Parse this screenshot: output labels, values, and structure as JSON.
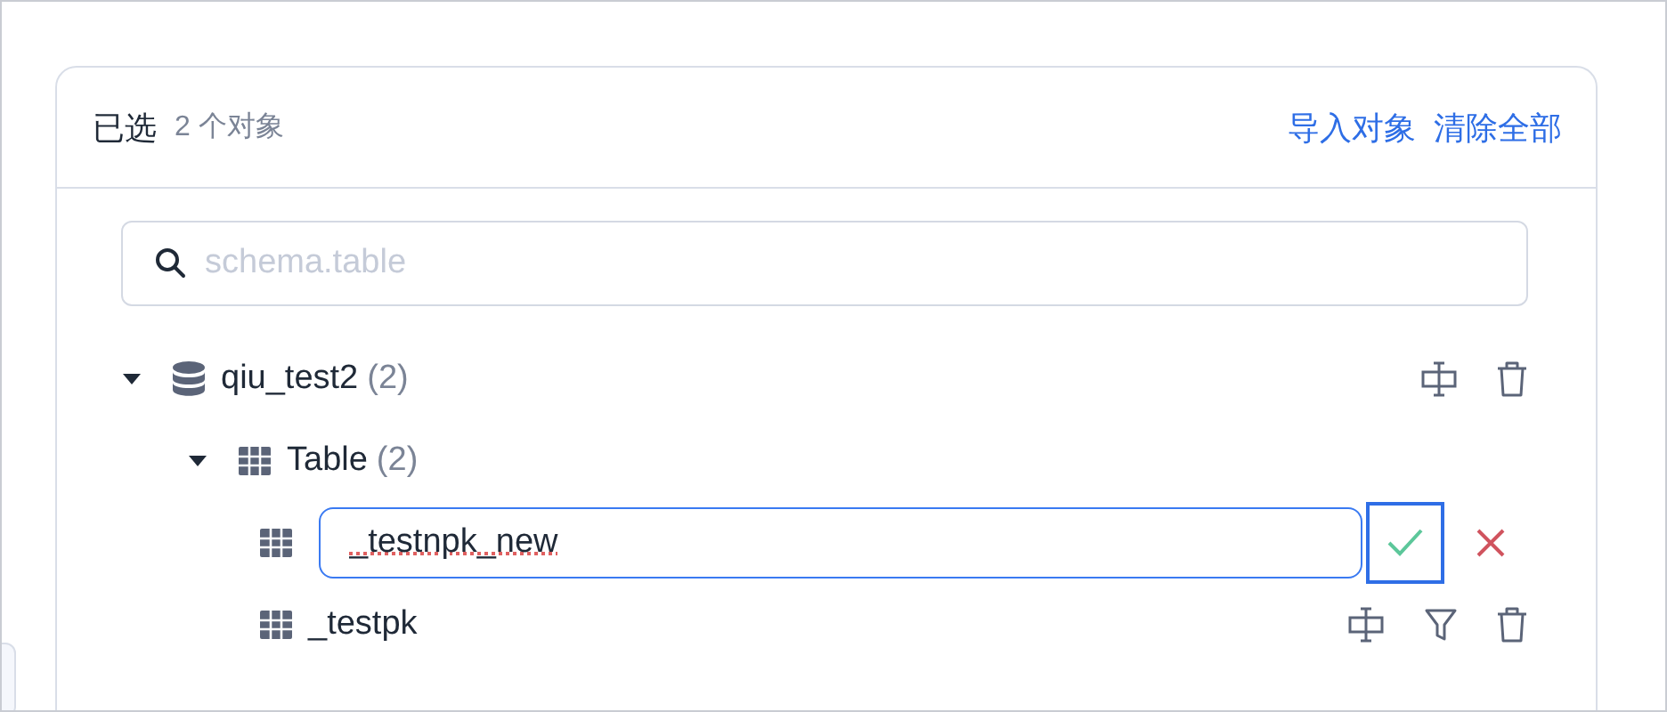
{
  "header": {
    "title": "已选",
    "count": "2 个对象",
    "actions": [
      "导入对象",
      "清除全部"
    ]
  },
  "search": {
    "placeholder": "schema.table"
  },
  "tree": [
    {
      "kind": "database",
      "name": "qiu_test2",
      "count": "(2)",
      "expanded": true,
      "children": [
        {
          "kind": "group",
          "name": "Table",
          "count": "(2)",
          "expanded": true,
          "children": [
            {
              "kind": "editing",
              "value": "_testnpk_new"
            },
            {
              "kind": "table",
              "name": "_testpk"
            }
          ]
        }
      ]
    }
  ]
}
